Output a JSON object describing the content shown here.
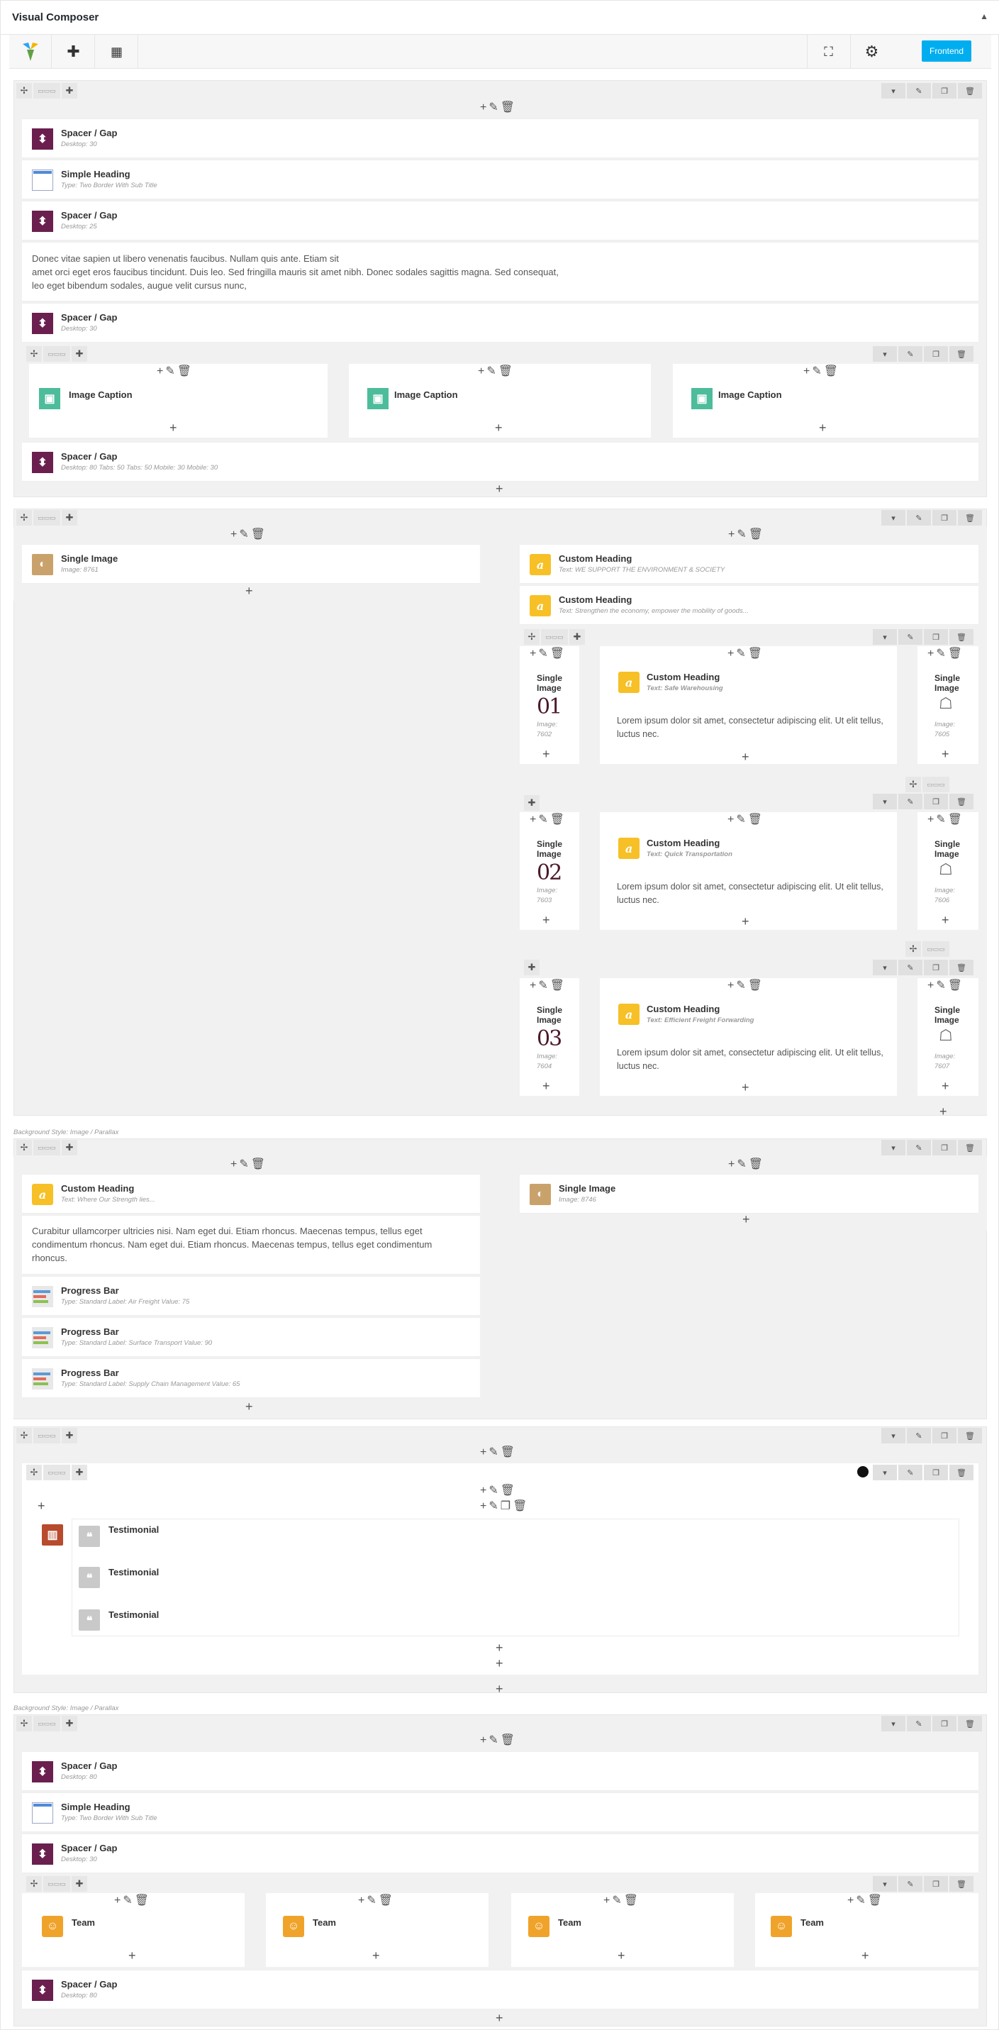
{
  "header": {
    "title": "Visual Composer",
    "collapse_icon": "caret-up-icon"
  },
  "toolbar": {
    "logo_icon": "vc-logo-icon",
    "add_icon": "plus-icon",
    "templates_icon": "layout-icon",
    "fullscreen_icon": "fullscreen-icon",
    "settings_icon": "gear-icon",
    "settings_badge": "",
    "frontend_label": "Frontend",
    "accent": "#00aef0"
  },
  "section1": {
    "spacer1": {
      "name": "Spacer / Gap",
      "sub": "Desktop: 30"
    },
    "heading": {
      "name": "Simple Heading",
      "sub": "Type: Two Border With Sub Title"
    },
    "spacer2": {
      "name": "Spacer / Gap",
      "sub": "Desktop: 25"
    },
    "text": [
      "Donec vitae sapien ut libero venenatis faucibus. Nullam quis ante. Etiam sit",
      "amet orci eget eros faucibus tincidunt. Duis leo. Sed fringilla mauris sit amet nibh. Donec sodales sagittis magna. Sed consequat,",
      "leo eget bibendum sodales, augue velit cursus nunc,"
    ],
    "spacer3": {
      "name": "Spacer / Gap",
      "sub": "Desktop: 30"
    },
    "captions": [
      "Image Caption",
      "Image Caption",
      "Image Caption"
    ],
    "spacer4": {
      "name": "Spacer / Gap",
      "sub": "Desktop: 80   Tabs: 50   Tabs: 50   Mobile: 30   Mobile: 30"
    }
  },
  "section2": {
    "single_image": {
      "name": "Single Image",
      "sub": "Image: 8761"
    },
    "ch1": {
      "name": "Custom Heading",
      "sub": "Text: WE SUPPORT THE ENVIRONMENT & SOCIETY"
    },
    "ch2": {
      "name": "Custom Heading",
      "sub": "Text: Strengthen the economy, empower the mobility of goods..."
    },
    "rows": [
      {
        "left_name": "Single Image",
        "left_num": "01",
        "left_sub": "Image: 7602",
        "mid_name": "Custom Heading",
        "mid_sub": "Text: Safe Warehousing",
        "text": "Lorem ipsum dolor sit amet, consectetur adipiscing elit. Ut elit tellus, luctus nec.",
        "right_name": "Single Image",
        "right_sub": "Image: 7605"
      },
      {
        "left_name": "Single Image",
        "left_num": "02",
        "left_sub": "Image: 7603",
        "mid_name": "Custom Heading",
        "mid_sub": "Text: Quick Transportation",
        "text": "Lorem ipsum dolor sit amet, consectetur adipiscing elit. Ut elit tellus, luctus nec.",
        "right_name": "Single Image",
        "right_sub": "Image: 7606"
      },
      {
        "left_name": "Single Image",
        "left_num": "03",
        "left_sub": "Image: 7604",
        "mid_name": "Custom Heading",
        "mid_sub": "Text: Efficient Freight Forwarding",
        "text": "Lorem ipsum dolor sit amet, consectetur adipiscing elit. Ut elit tellus, luctus nec.",
        "right_name": "Single Image",
        "right_sub": "Image: 7607"
      }
    ]
  },
  "section3": {
    "bg_label": "Background Style: Image / Parallax",
    "ch": {
      "name": "Custom Heading",
      "sub": "Text: Where Our Strength lies..."
    },
    "text": [
      "Curabitur ullamcorper ultricies nisi. Nam eget dui. Etiam rhoncus. Maecenas tempus, tellus eget",
      "condimentum rhoncus. Nam eget dui. Etiam rhoncus. Maecenas tempus, tellus eget condimentum",
      "rhoncus."
    ],
    "pb1": {
      "name": "Progress Bar",
      "sub": "Type: Standard  Label: Air Freight  Value: 75"
    },
    "pb2": {
      "name": "Progress Bar",
      "sub": "Type: Standard  Label: Surface Transport  Value: 90"
    },
    "pb3": {
      "name": "Progress Bar",
      "sub": "Type: Standard  Label: Supply Chain Management  Value: 65"
    },
    "single_image": {
      "name": "Single Image",
      "sub": "Image: 8746"
    }
  },
  "section4": {
    "testimonials": [
      "Testimonial",
      "Testimonial",
      "Testimonial"
    ]
  },
  "section5": {
    "bg_label": "Background Style: Image / Parallax",
    "spacer1": {
      "name": "Spacer / Gap",
      "sub": "Desktop: 80"
    },
    "heading": {
      "name": "Simple Heading",
      "sub": "Type: Two Border With Sub Title"
    },
    "spacer2": {
      "name": "Spacer / Gap",
      "sub": "Desktop: 30"
    },
    "teams": [
      "Team",
      "Team",
      "Team",
      "Team"
    ],
    "spacer3": {
      "name": "Spacer / Gap",
      "sub": "Desktop: 80"
    }
  }
}
